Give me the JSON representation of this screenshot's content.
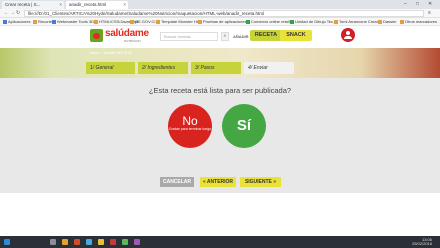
{
  "browser": {
    "tabs": [
      {
        "title": "Crear receta | S..."
      },
      {
        "title": "anadir_receta.html"
      }
    ],
    "url": "file:///D:/01_Clientes/ARTICA%20Hyde/Saludame/Saludame%20Nutricion/maquetacion/HTML-web/anadir_receta.html",
    "bookmarks": [
      "Aplicaciones",
      "Recortes",
      "Webmaster Tools 3D",
      "HTML/CSS/Javascript",
      "GE.GOV.CI",
      "Template Monster Ht...",
      "Pruebas de aplicaciones...",
      "Comercio online retail...",
      "Unidad de Dibujo Tec...",
      "Tomi Arrancone Crear...",
      "Dassier",
      "Otros marcadores"
    ],
    "window_controls": [
      "–",
      "□",
      "✕"
    ]
  },
  "site": {
    "logo_text": "salúdame",
    "logo_sub": "NUTRICION",
    "search_placeholder": "Buscar recetas",
    "add_label": "AÑADIR",
    "receta_label": "RECETA",
    "snack_label": "SNACK",
    "breadcrumb": "Inicio > Añadir RECETA"
  },
  "steps": [
    {
      "label": "1/ General"
    },
    {
      "label": "2/ Ingredientes"
    },
    {
      "label": "3/ Pasos"
    },
    {
      "label": "4/ Enviar"
    }
  ],
  "main": {
    "question": "¿Esta receta está lista para ser publicada?",
    "no_label": "No",
    "no_sub": "Grabar para terminar luego",
    "si_label": "Sí",
    "cancel_label": "CANCELAR",
    "prev_label": "« ANTERIOR",
    "next_label": "SIGUIENTE »"
  },
  "taskbar": {
    "time": "13:06",
    "date": "25/02/2016"
  },
  "colors": {
    "accent_green": "#c7d33a",
    "accent_yellow": "#e9e23a",
    "no_red": "#d8231f",
    "si_green": "#44a744"
  }
}
